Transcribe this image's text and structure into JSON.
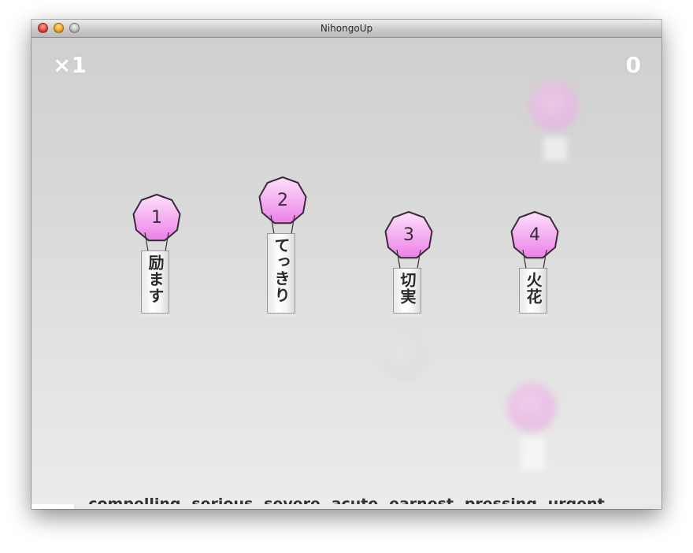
{
  "window": {
    "title": "NihongoUp"
  },
  "hud": {
    "multiplier": "×1",
    "score": "0"
  },
  "balloons": [
    {
      "number": "1",
      "word": "励ます"
    },
    {
      "number": "2",
      "word": "てっきり"
    },
    {
      "number": "3",
      "word": "切実"
    },
    {
      "number": "4",
      "word": "火花"
    }
  ],
  "definition": "compelling, serious, severe, acute, earnest, pressing, urgent",
  "progress": {
    "fraction": 0.068
  },
  "colors": {
    "balloon_fill_top": "#fde1fb",
    "balloon_fill_bottom": "#ec80e6",
    "balloon_stroke": "#3a2a3a",
    "definition_text": "#333333",
    "hud_text": "#ffffff"
  }
}
